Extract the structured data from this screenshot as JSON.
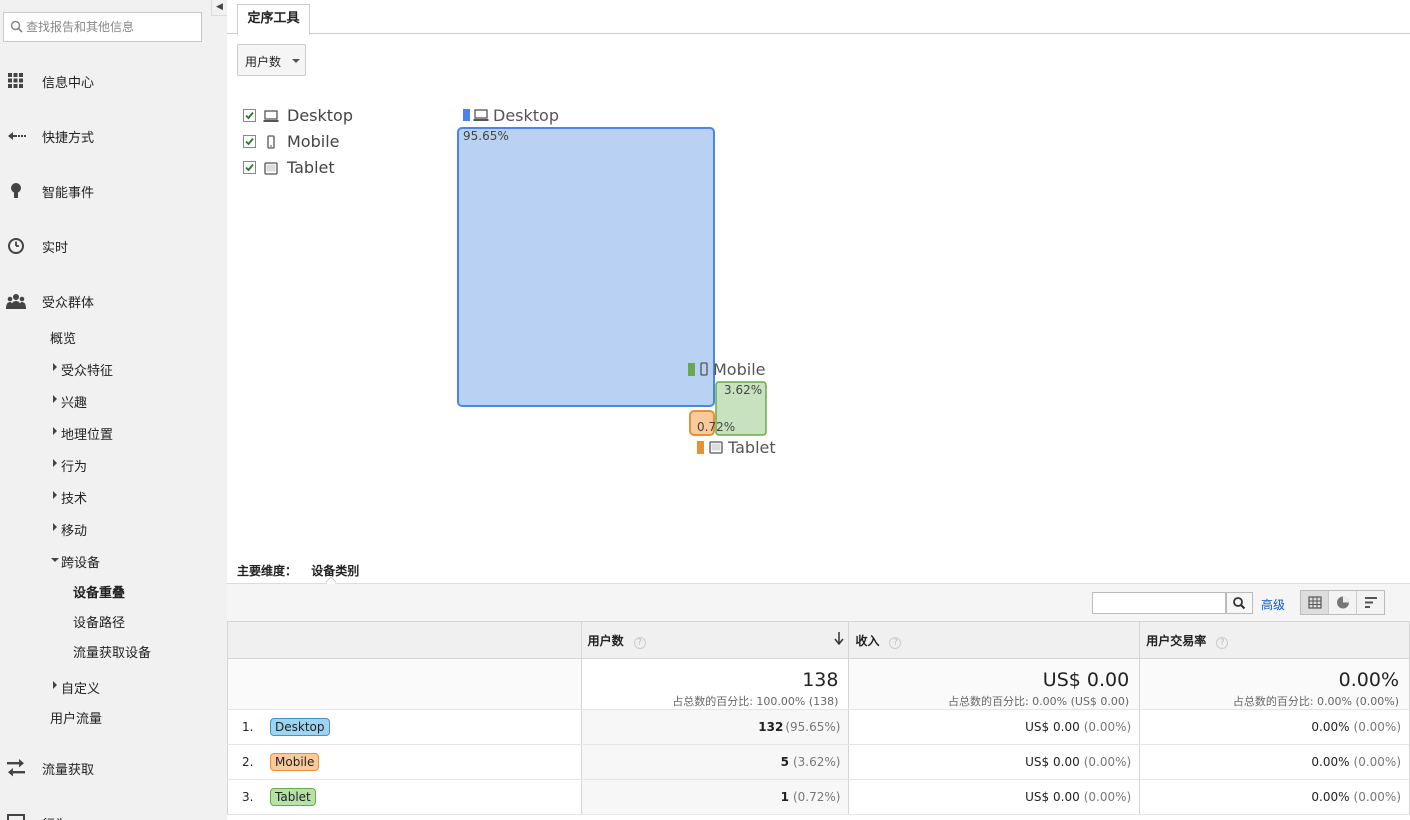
{
  "sidebar": {
    "search_placeholder": "查找报告和其他信息",
    "main_items": [
      {
        "label": "信息中心",
        "icon": "grid-icon"
      },
      {
        "label": "快捷方式",
        "icon": "shortcut-arrow-icon"
      },
      {
        "label": "智能事件",
        "icon": "lightbulb-icon"
      },
      {
        "label": "实时",
        "icon": "clock-icon"
      },
      {
        "label": "受众群体",
        "icon": "people-icon"
      }
    ],
    "audience_items": [
      {
        "label": "概览"
      },
      {
        "label": "受众特征"
      },
      {
        "label": "兴趣"
      },
      {
        "label": "地理位置"
      },
      {
        "label": "行为"
      },
      {
        "label": "技术"
      },
      {
        "label": "移动"
      },
      {
        "label": "跨设备"
      },
      {
        "label": "设备重叠"
      },
      {
        "label": "设备路径"
      },
      {
        "label": "流量获取设备"
      },
      {
        "label": "自定义"
      },
      {
        "label": "用户流量"
      }
    ],
    "acquisition": {
      "label": "流量获取",
      "icon": "acquisition-arrows-icon"
    },
    "behavior": {
      "label": "行为"
    }
  },
  "tab": {
    "label": "定序工具"
  },
  "metric_select": {
    "value": "用户数"
  },
  "legend": [
    {
      "label": "Desktop",
      "checked": true,
      "icon": "desktop-icon"
    },
    {
      "label": "Mobile",
      "checked": true,
      "icon": "mobile-icon"
    },
    {
      "label": "Tablet",
      "checked": true,
      "icon": "tablet-icon"
    }
  ],
  "venn": {
    "desktop": {
      "label": "Desktop",
      "pct": "95.65%",
      "color": "#4a86e8",
      "fill": "#b9d1f2"
    },
    "mobile": {
      "label": "Mobile",
      "pct": "3.62%",
      "color": "#6aa84f",
      "fill": "#c8e2c0"
    },
    "tablet": {
      "label": "Tablet",
      "pct": "0.72%",
      "color": "#e69138",
      "fill": "#f9cb9c"
    }
  },
  "dimension": {
    "label": "主要维度：",
    "value": "设备类别"
  },
  "toolbar": {
    "advanced": "高级"
  },
  "table": {
    "headers": {
      "users": "用户数",
      "revenue": "收入",
      "conv": "用户交易率"
    },
    "totals": {
      "users": "138",
      "users_sub": "占总数的百分比: 100.00% (138)",
      "revenue": "US$ 0.00",
      "revenue_sub": "占总数的百分比: 0.00% (US$ 0.00)",
      "conv": "0.00%",
      "conv_sub": "占总数的百分比: 0.00% (0.00%)"
    },
    "rows": [
      {
        "num": "1.",
        "device": "Desktop",
        "users": "132",
        "users_pct": "(95.65%)",
        "revenue": "US$ 0.00",
        "revenue_pct": "(0.00%)",
        "conv": "0.00%",
        "conv_pct": "(0.00%)",
        "color": "#9fd4ee",
        "border": "#4a90c2"
      },
      {
        "num": "2.",
        "device": "Mobile",
        "users": "5",
        "users_pct": "(3.62%)",
        "revenue": "US$ 0.00",
        "revenue_pct": "(0.00%)",
        "conv": "0.00%",
        "conv_pct": "(0.00%)",
        "color": "#f9cb9c",
        "border": "#e69138"
      },
      {
        "num": "3.",
        "device": "Tablet",
        "users": "1",
        "users_pct": "(0.72%)",
        "revenue": "US$ 0.00",
        "revenue_pct": "(0.00%)",
        "conv": "0.00%",
        "conv_pct": "(0.00%)",
        "color": "#b6e2a8",
        "border": "#6aa84f"
      }
    ]
  }
}
